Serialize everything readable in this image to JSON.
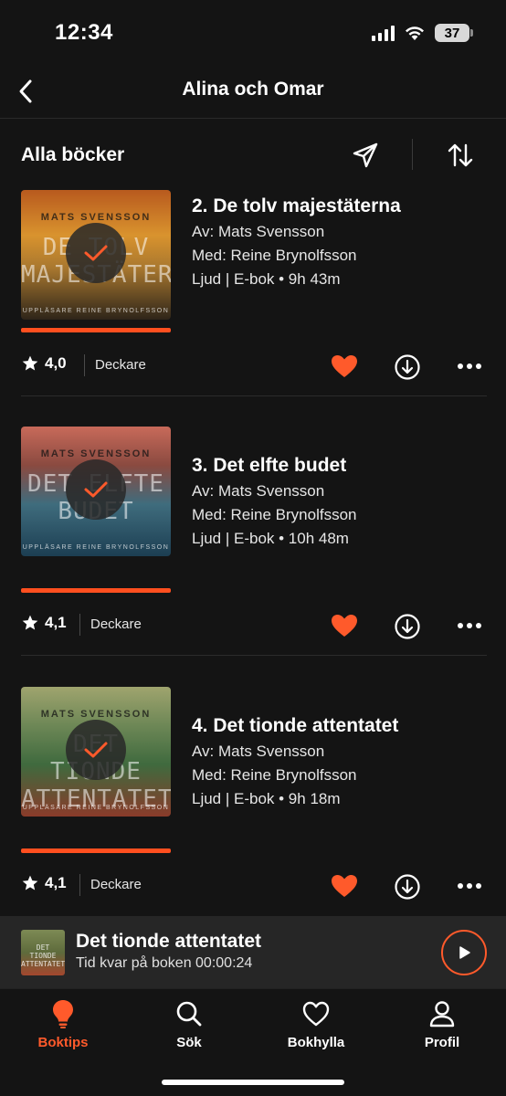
{
  "status_bar": {
    "time": "12:34",
    "battery": "37"
  },
  "header": {
    "title": "Alina och Omar"
  },
  "section": {
    "title": "Alla böcker"
  },
  "books": [
    {
      "title": "2. De tolv majestäterna",
      "author": "Av: Mats Svensson",
      "narrator": "Med: Reine Brynolfsson",
      "format": "Ljud | E-bok  •  9h 43m",
      "rating": "4,0",
      "genre": "Deckare",
      "cover_author": "MATS SVENSSON",
      "cover_title": "DE TOLV MAJESTÄTERNA",
      "cover_narrator": "UPPLÄSARE REINE BRYNOLFSSON",
      "progress": 1.0
    },
    {
      "title": "3. Det elfte budet",
      "author": "Av: Mats Svensson",
      "narrator": "Med: Reine Brynolfsson",
      "format": "Ljud | E-bok  •  10h 48m",
      "rating": "4,1",
      "genre": "Deckare",
      "cover_author": "MATS SVENSSON",
      "cover_title": "DET ELFTE BUDET",
      "cover_narrator": "UPPLÄSARE REINE BRYNOLFSSON",
      "progress": 1.0
    },
    {
      "title": "4. Det tionde attentatet",
      "author": "Av: Mats Svensson",
      "narrator": "Med: Reine Brynolfsson",
      "format": "Ljud | E-bok  •  9h 18m",
      "rating": "4,1",
      "genre": "Deckare",
      "cover_author": "MATS SVENSSON",
      "cover_title": "DET TIONDE ATTENTATET",
      "cover_narrator": "UPPLÄSARE REINE BRYNOLFSSON",
      "progress": 1.0
    }
  ],
  "mini_player": {
    "title": "Det tionde attentatet",
    "subtitle": "Tid kvar på boken 00:00:24",
    "cover_title": "DET TIONDE ATTENTATET"
  },
  "tabs": [
    {
      "label": "Boktips",
      "icon": "lightbulb-icon",
      "active": true
    },
    {
      "label": "Sök",
      "icon": "search-icon",
      "active": false
    },
    {
      "label": "Bokhylla",
      "icon": "heart-icon",
      "active": false
    },
    {
      "label": "Profil",
      "icon": "profile-icon",
      "active": false
    }
  ],
  "colors": {
    "accent": "#ff5a2b",
    "background": "#141414",
    "mini_player": "#262626"
  }
}
